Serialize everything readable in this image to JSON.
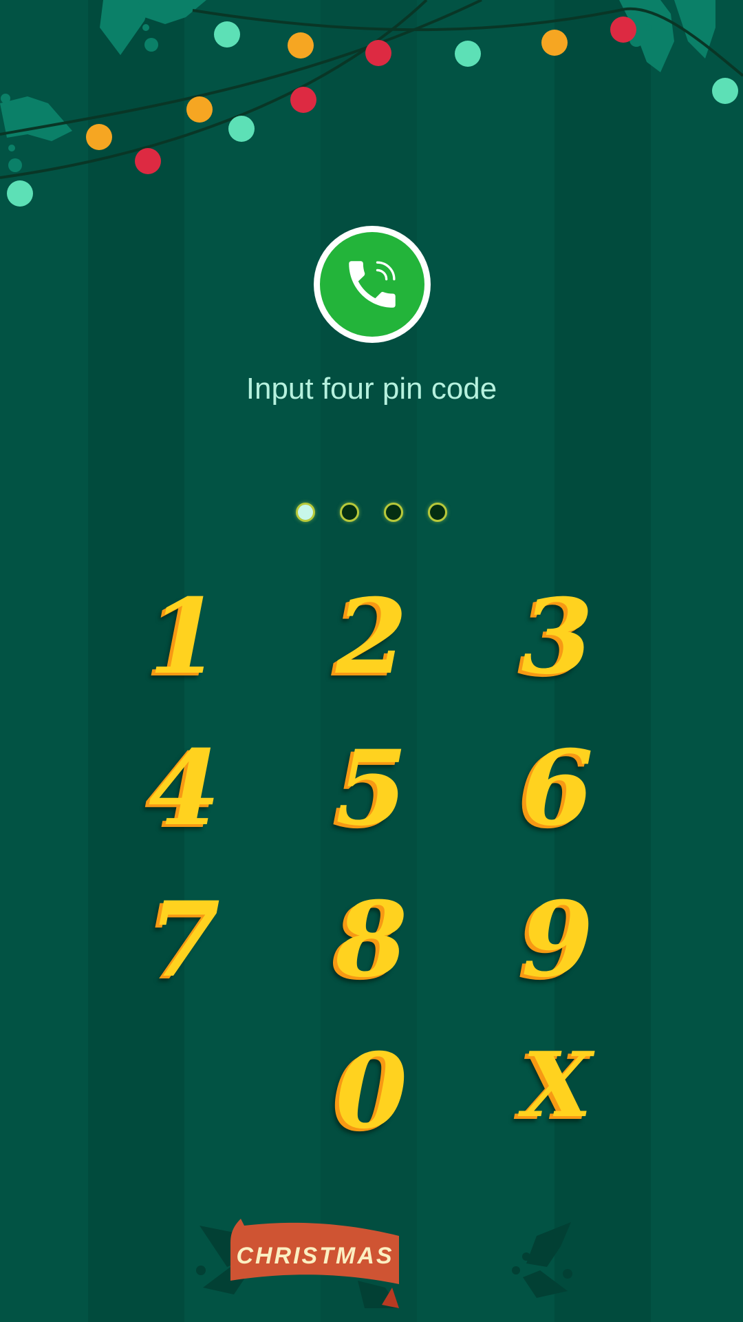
{
  "header": {
    "call_icon": "phone-call-icon",
    "prompt": "Input four pin code"
  },
  "pin": {
    "length": 4,
    "entered": 1
  },
  "keypad": {
    "keys": [
      {
        "label": "1",
        "action": "digit"
      },
      {
        "label": "2",
        "action": "digit"
      },
      {
        "label": "3",
        "action": "digit"
      },
      {
        "label": "4",
        "action": "digit"
      },
      {
        "label": "5",
        "action": "digit"
      },
      {
        "label": "6",
        "action": "digit"
      },
      {
        "label": "7",
        "action": "digit"
      },
      {
        "label": "8",
        "action": "digit"
      },
      {
        "label": "9",
        "action": "digit"
      },
      {
        "label": "0",
        "action": "digit"
      },
      {
        "label": "X",
        "action": "delete"
      }
    ]
  },
  "footer": {
    "banner_text": "CHRISTMAS"
  },
  "colors": {
    "background": "#025344",
    "digit_face": "#ffd21f",
    "digit_side": "#f79914",
    "prompt_text": "#b6f1de",
    "call_green": "#23b43a",
    "banner_red": "#cf5433",
    "banner_text": "#fbefc2",
    "dot_ring": "#b8c93a",
    "dot_filled": "#c8f7ea",
    "dot_empty": "#042e12"
  }
}
